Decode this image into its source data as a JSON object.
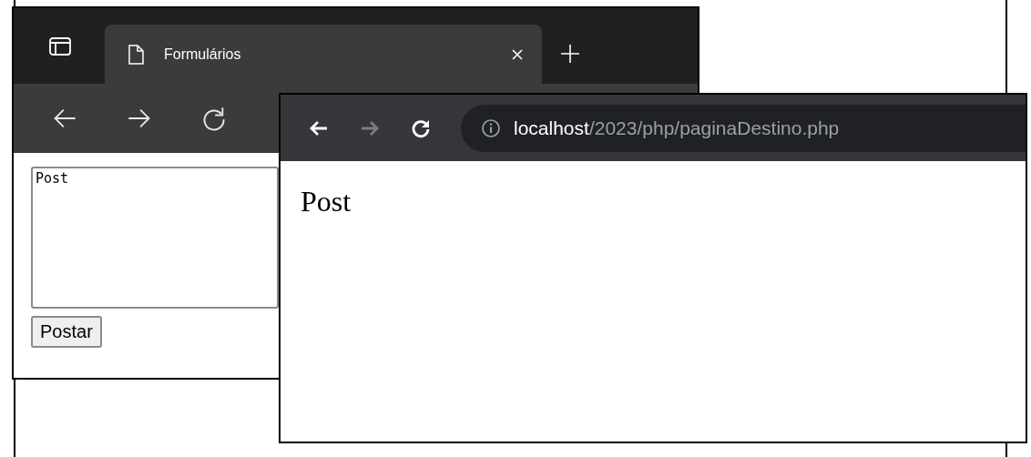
{
  "back_window": {
    "tabs": [
      {
        "title": "Formulários",
        "selected": true
      }
    ],
    "nav": [
      {
        "kind": "back",
        "disabled": false
      },
      {
        "kind": "forward",
        "disabled": false
      },
      {
        "kind": "reload",
        "disabled": false
      }
    ],
    "textarea": {
      "value": "Post"
    },
    "button": "Postar"
  },
  "front_window": {
    "nav": [
      {
        "kind": "back",
        "disabled": false
      },
      {
        "kind": "forward",
        "disabled": true
      },
      {
        "kind": "reload",
        "disabled": false
      }
    ],
    "address": {
      "host": "localhost",
      "path": "/2023/php/paginaDestino.php"
    },
    "content": "Post"
  }
}
